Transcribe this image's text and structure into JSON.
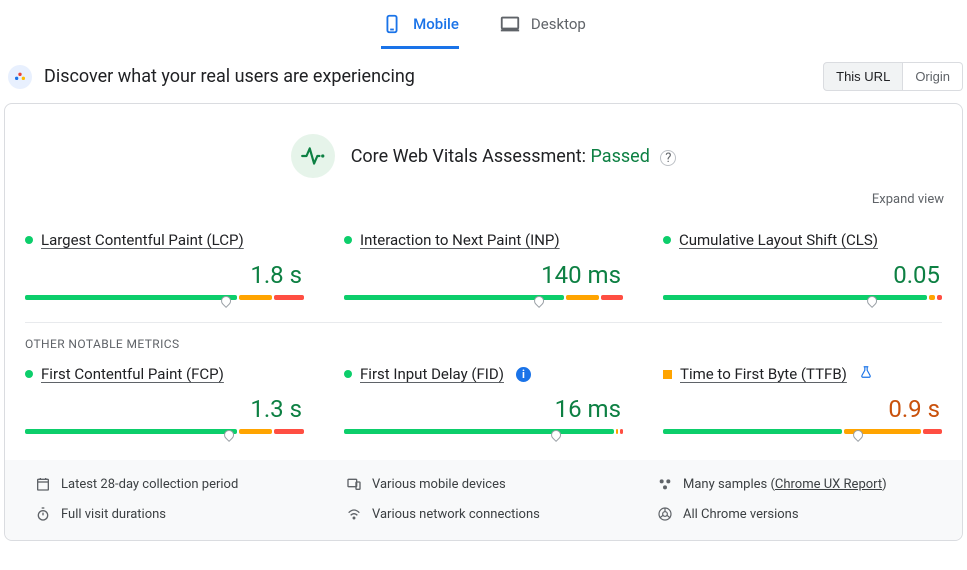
{
  "tabs": {
    "mobile": "Mobile",
    "desktop": "Desktop"
  },
  "header": {
    "title": "Discover what your real users are experiencing",
    "thisUrl": "This URL",
    "origin": "Origin"
  },
  "assessment": {
    "label": "Core Web Vitals Assessment:",
    "status": "Passed"
  },
  "expand": "Expand view",
  "coreMetrics": [
    {
      "name": "Largest Contentful Paint (LCP)",
      "value": "1.8 s",
      "status": "green",
      "bar": {
        "g": 77,
        "o": 12,
        "r": 11,
        "marker": 72
      }
    },
    {
      "name": "Interaction to Next Paint (INP)",
      "value": "140 ms",
      "status": "green",
      "bar": {
        "g": 80,
        "o": 12,
        "r": 8,
        "marker": 70
      }
    },
    {
      "name": "Cumulative Layout Shift (CLS)",
      "value": "0.05",
      "status": "green",
      "bar": {
        "g": 96,
        "o": 2,
        "r": 2,
        "marker": 75
      }
    }
  ],
  "otherLabel": "OTHER NOTABLE METRICS",
  "otherMetrics": [
    {
      "name": "First Contentful Paint (FCP)",
      "value": "1.3 s",
      "status": "green",
      "bar": {
        "g": 77,
        "o": 12,
        "r": 11,
        "marker": 73
      },
      "badge": null
    },
    {
      "name": "First Input Delay (FID)",
      "value": "16 ms",
      "status": "green",
      "bar": {
        "g": 98,
        "o": 1,
        "r": 1,
        "marker": 76
      },
      "badge": "info"
    },
    {
      "name": "Time to First Byte (TTFB)",
      "value": "0.9 s",
      "status": "orange",
      "bar": {
        "g": 65,
        "o": 28,
        "r": 7,
        "marker": 70
      },
      "badge": "flask"
    }
  ],
  "footer": {
    "period": "Latest 28-day collection period",
    "devices": "Various mobile devices",
    "samplesPrefix": "Many samples (",
    "samplesLink": "Chrome UX Report",
    "samplesSuffix": ")",
    "durations": "Full visit durations",
    "network": "Various network connections",
    "versions": "All Chrome versions"
  }
}
